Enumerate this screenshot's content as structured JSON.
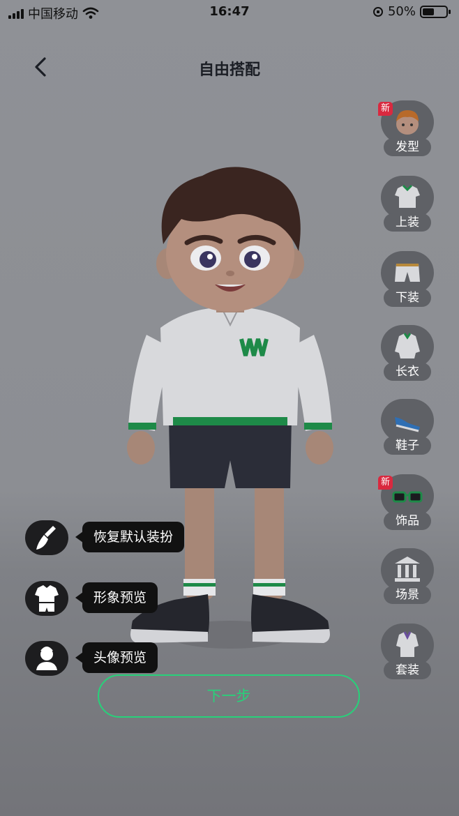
{
  "status_bar": {
    "carrier": "中国移动",
    "time": "16:47",
    "battery_percent": "50%",
    "battery_level": 0.5
  },
  "header": {
    "title": "自由搭配",
    "back_icon": "chevron-left-icon"
  },
  "categories": [
    {
      "label": "发型",
      "badge": "新",
      "icon": "hairstyle-icon"
    },
    {
      "label": "上装",
      "badge": "",
      "icon": "top-icon"
    },
    {
      "label": "下装",
      "badge": "",
      "icon": "bottoms-icon"
    },
    {
      "label": "长衣",
      "badge": "",
      "icon": "long-shirt-icon"
    },
    {
      "label": "鞋子",
      "badge": "",
      "icon": "shoe-icon"
    },
    {
      "label": "饰品",
      "badge": "新",
      "icon": "glasses-icon"
    },
    {
      "label": "场景",
      "badge": "",
      "icon": "building-icon"
    },
    {
      "label": "套装",
      "badge": "",
      "icon": "suit-icon"
    }
  ],
  "actions": [
    {
      "label": "恢复默认装扮",
      "icon": "broom-icon"
    },
    {
      "label": "形象预览",
      "icon": "outfit-icon"
    },
    {
      "label": "头像预览",
      "icon": "portrait-icon"
    }
  ],
  "next_button": {
    "label": "下一步"
  },
  "colors": {
    "accent": "#27d27a",
    "badge": "#d9293f",
    "overlay_bubble": "#111111"
  }
}
